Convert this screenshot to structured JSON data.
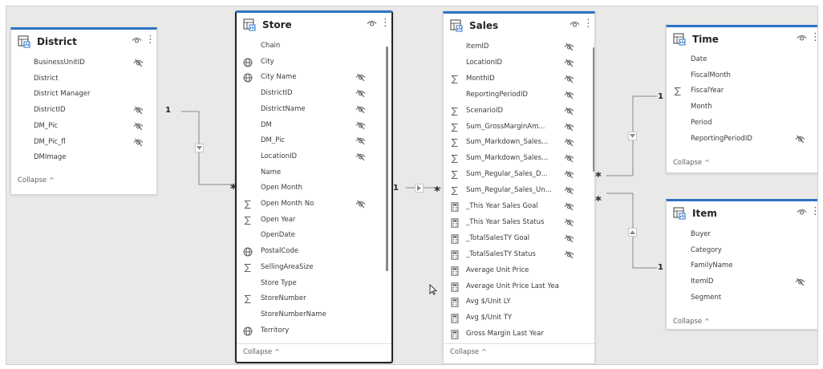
{
  "tables": [
    {
      "title": "District",
      "fields": [
        {
          "name": "BusinessUnitID",
          "icon": "none",
          "hidden": true
        },
        {
          "name": "District",
          "icon": "none",
          "hidden": false
        },
        {
          "name": "District Manager",
          "icon": "none",
          "hidden": false
        },
        {
          "name": "DistrictID",
          "icon": "none",
          "hidden": true
        },
        {
          "name": "DM_Pic",
          "icon": "none",
          "hidden": true
        },
        {
          "name": "DM_Pic_fl",
          "icon": "none",
          "hidden": true
        },
        {
          "name": "DMImage",
          "icon": "none",
          "hidden": false
        }
      ],
      "collapse": "Collapse"
    },
    {
      "title": "Store",
      "fields": [
        {
          "name": "Chain",
          "icon": "none",
          "hidden": false
        },
        {
          "name": "City",
          "icon": "globe",
          "hidden": false
        },
        {
          "name": "City Name",
          "icon": "globe",
          "hidden": true
        },
        {
          "name": "DistrictID",
          "icon": "none",
          "hidden": true
        },
        {
          "name": "DistrictName",
          "icon": "none",
          "hidden": true
        },
        {
          "name": "DM",
          "icon": "none",
          "hidden": true
        },
        {
          "name": "DM_Pic",
          "icon": "none",
          "hidden": true
        },
        {
          "name": "LocationID",
          "icon": "none",
          "hidden": true
        },
        {
          "name": "Name",
          "icon": "none",
          "hidden": false
        },
        {
          "name": "Open Month",
          "icon": "none",
          "hidden": false
        },
        {
          "name": "Open Month No",
          "icon": "sigma",
          "hidden": true
        },
        {
          "name": "Open Year",
          "icon": "sigma",
          "hidden": false
        },
        {
          "name": "OpenDate",
          "icon": "none",
          "hidden": false
        },
        {
          "name": "PostalCode",
          "icon": "globe",
          "hidden": false
        },
        {
          "name": "SellingAreaSize",
          "icon": "sigma",
          "hidden": false
        },
        {
          "name": "Store Type",
          "icon": "none",
          "hidden": false
        },
        {
          "name": "StoreNumber",
          "icon": "sigma",
          "hidden": false
        },
        {
          "name": "StoreNumberName",
          "icon": "none",
          "hidden": false
        },
        {
          "name": "Territory",
          "icon": "globe",
          "hidden": false
        }
      ],
      "collapse": "Collapse"
    },
    {
      "title": "Sales",
      "fields": [
        {
          "name": "ItemID",
          "icon": "none",
          "hidden": true
        },
        {
          "name": "LocationID",
          "icon": "none",
          "hidden": true
        },
        {
          "name": "MonthID",
          "icon": "sigma",
          "hidden": true
        },
        {
          "name": "ReportingPeriodID",
          "icon": "none",
          "hidden": true
        },
        {
          "name": "ScenarioID",
          "icon": "sigma",
          "hidden": true
        },
        {
          "name": "Sum_GrossMarginAm...",
          "icon": "sigma",
          "hidden": true
        },
        {
          "name": "Sum_Markdown_Sales...",
          "icon": "sigma",
          "hidden": true
        },
        {
          "name": "Sum_Markdown_Sales...",
          "icon": "sigma",
          "hidden": true
        },
        {
          "name": "Sum_Regular_Sales_D...",
          "icon": "sigma",
          "hidden": true
        },
        {
          "name": "Sum_Regular_Sales_Un...",
          "icon": "sigma",
          "hidden": true
        },
        {
          "name": "_This Year Sales Goal",
          "icon": "calc",
          "hidden": true
        },
        {
          "name": "_This Year Sales Status",
          "icon": "calc",
          "hidden": true
        },
        {
          "name": "_TotalSalesTY Goal",
          "icon": "calc",
          "hidden": true
        },
        {
          "name": "_TotalSalesTY Status",
          "icon": "calc",
          "hidden": true
        },
        {
          "name": "Average Unit Price",
          "icon": "calc",
          "hidden": false
        },
        {
          "name": "Average Unit Price Last Year",
          "icon": "calc",
          "hidden": false
        },
        {
          "name": "Avg $/Unit LY",
          "icon": "calc",
          "hidden": false
        },
        {
          "name": "Avg $/Unit TY",
          "icon": "calc",
          "hidden": false
        },
        {
          "name": "Gross Margin Last Year",
          "icon": "calc",
          "hidden": false
        }
      ],
      "collapse": "Collapse"
    },
    {
      "title": "Time",
      "fields": [
        {
          "name": "Date",
          "icon": "none",
          "hidden": false
        },
        {
          "name": "FiscalMonth",
          "icon": "none",
          "hidden": false
        },
        {
          "name": "FiscalYear",
          "icon": "sigma",
          "hidden": false
        },
        {
          "name": "Month",
          "icon": "none",
          "hidden": false
        },
        {
          "name": "Period",
          "icon": "none",
          "hidden": false
        },
        {
          "name": "ReportingPeriodID",
          "icon": "none",
          "hidden": true
        }
      ],
      "collapse": "Collapse"
    },
    {
      "title": "Item",
      "fields": [
        {
          "name": "Buyer",
          "icon": "none",
          "hidden": false
        },
        {
          "name": "Category",
          "icon": "none",
          "hidden": false
        },
        {
          "name": "FamilyName",
          "icon": "none",
          "hidden": false
        },
        {
          "name": "ItemID",
          "icon": "none",
          "hidden": true
        },
        {
          "name": "Segment",
          "icon": "none",
          "hidden": false
        }
      ],
      "collapse": "Collapse"
    }
  ],
  "relationships": {
    "district_store": {
      "from": "1",
      "to": "*"
    },
    "store_sales": {
      "from": "1",
      "to": "*"
    },
    "time_sales": {
      "from": "1",
      "to": "*"
    },
    "item_sales": {
      "from": "1",
      "to": "*"
    }
  },
  "icons": {
    "table": "table-icon",
    "visibility": "eye-icon",
    "hidden": "eye-slash-icon",
    "more": "more-options-icon",
    "globe": "globe-icon",
    "sigma": "sigma-icon",
    "calc": "calculator-icon",
    "cursor": "cursor-icon"
  },
  "colors": {
    "accent": "#2b73c4",
    "canvas": "#eae9e8"
  }
}
